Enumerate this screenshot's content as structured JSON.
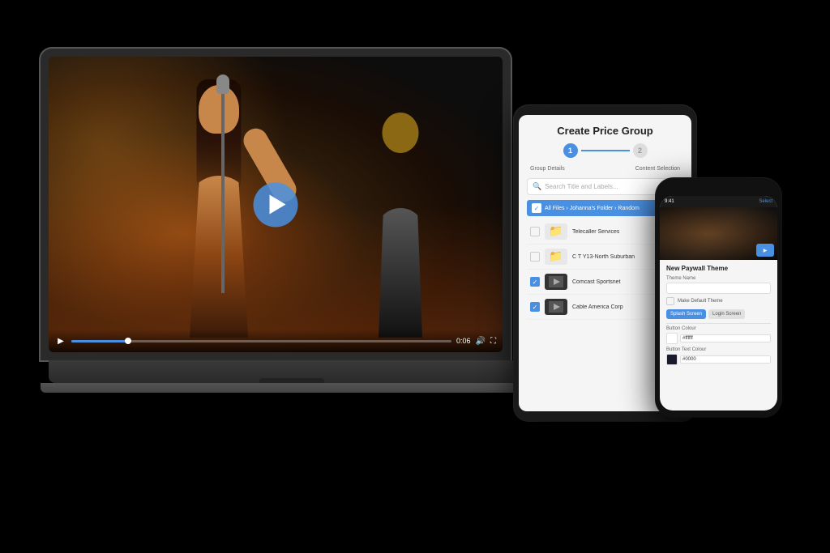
{
  "scene": {
    "background": "#000000"
  },
  "laptop": {
    "video": {
      "play_button_label": "▶",
      "time": "0:06",
      "progress_percent": 15
    }
  },
  "tablet": {
    "title": "Create Price Group",
    "step1_label": "Group Details",
    "step2_label": "Content Selection",
    "search_placeholder": "Search Title and Labels...",
    "breadcrumb": "All Files › Johanna's Folder › Random",
    "files": [
      {
        "name": "Telecaller Services",
        "type": "folder",
        "checked": false
      },
      {
        "name": "C T Y13-North Suburban",
        "type": "folder",
        "checked": false
      },
      {
        "name": "Comcast Sportsnet",
        "type": "video",
        "checked": true
      },
      {
        "name": "Cable America Corp",
        "type": "video",
        "checked": true
      }
    ]
  },
  "phone": {
    "header": {
      "status": "9:41",
      "button": "Select"
    },
    "section_title": "New Paywall Theme",
    "theme_name_label": "Theme Name",
    "default_theme_label": "Make Default Theme",
    "splash_tab": "Splash Screen",
    "login_tab": "Login Screen",
    "button_colour_label": "Button Colour",
    "button_colour_value": "#ffffff",
    "button_text_colour_label": "Button Text Colour",
    "button_text_colour_value": "#0000"
  }
}
